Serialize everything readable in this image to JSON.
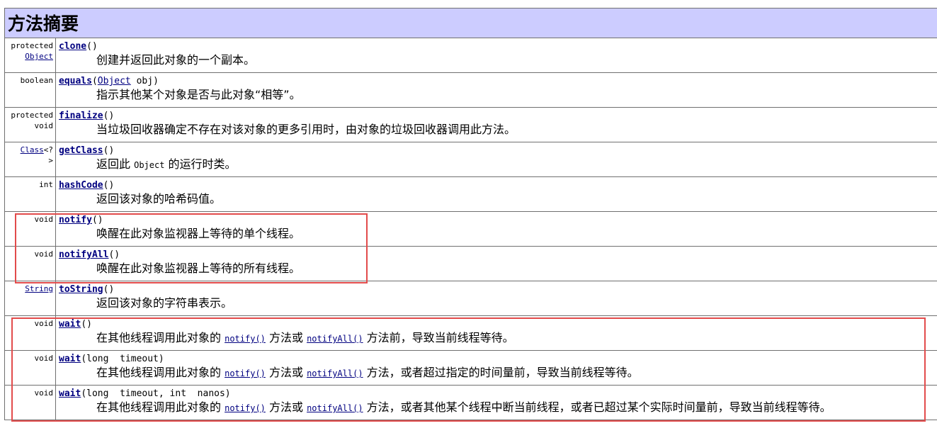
{
  "title": "方法摘要",
  "methods": [
    {
      "type_lines": [
        "protected",
        "Object"
      ],
      "type_link_line": 1,
      "name": "clone",
      "params": "()",
      "desc": [
        "创建并返回此对象的一个副本。"
      ]
    },
    {
      "type_lines": [
        "boolean"
      ],
      "name": "equals",
      "params_parts": [
        "(",
        "Object",
        " obj)"
      ],
      "desc": [
        "指示其他某个对象是否与此对象“相等”。"
      ]
    },
    {
      "type_lines": [
        "protected",
        "void"
      ],
      "name": "finalize",
      "params": "()",
      "desc": [
        "当垃圾回收器确定不存在对该对象的更多引用时，由对象的垃圾回收器调用此方法。"
      ]
    },
    {
      "type_link": "Class",
      "type_rest": "<?",
      "type_line2": ">",
      "name": "getClass",
      "params": "()",
      "desc_parts": [
        "返回此 ",
        "Object",
        " 的运行时类。"
      ]
    },
    {
      "type_lines": [
        "int"
      ],
      "name": "hashCode",
      "params": "()",
      "desc": [
        "返回该对象的哈希码值。"
      ]
    },
    {
      "type_lines": [
        "void"
      ],
      "name": "notify",
      "params": "()",
      "desc": [
        "唤醒在此对象监视器上等待的单个线程。"
      ]
    },
    {
      "type_lines": [
        "void"
      ],
      "name": "notifyAll",
      "params": "()",
      "desc": [
        "唤醒在此对象监视器上等待的所有线程。"
      ]
    },
    {
      "type_link": "String",
      "name": "toString",
      "params": "()",
      "desc": [
        "返回该对象的字符串表示。"
      ]
    },
    {
      "type_lines": [
        "void"
      ],
      "name": "wait",
      "params": "()",
      "desc_parts": [
        "在其他线程调用此对象的 ",
        "notify()",
        " 方法或 ",
        "notifyAll()",
        " 方法前，导致当前线程等待。"
      ]
    },
    {
      "type_lines": [
        "void"
      ],
      "name": "wait",
      "params": "(long  timeout)",
      "desc_parts": [
        "在其他线程调用此对象的 ",
        "notify()",
        " 方法或 ",
        "notifyAll()",
        " 方法，或者超过指定的时间量前，导致当前线程等待。"
      ]
    },
    {
      "type_lines": [
        "void"
      ],
      "name": "wait",
      "params": "(long  timeout, int  nanos)",
      "desc_parts": [
        "在其他线程调用此对象的 ",
        "notify()",
        " 方法或 ",
        "notifyAll()",
        " 方法，或者其他某个线程中断当前线程，或者已超过某个实际时间量前，导致当前线程等待。"
      ]
    }
  ],
  "colors": {
    "header_bg": "#ccccff",
    "link": "#000080",
    "highlight": "#e24b4b",
    "border": "#707070"
  }
}
